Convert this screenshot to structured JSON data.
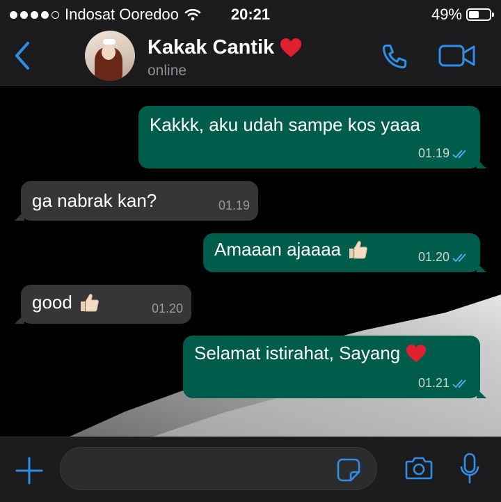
{
  "status_bar": {
    "carrier": "Indosat Ooredoo",
    "time": "20:21",
    "battery_text": "49%",
    "battery_level": 0.49,
    "signal_bars_filled": 4,
    "signal_bars_total": 5
  },
  "header": {
    "back_icon": "chevron-left-icon",
    "contact_name": "Kakak Cantik",
    "name_emoji": "heart",
    "status": "online",
    "call_icon": "phone-icon",
    "video_icon": "video-camera-icon"
  },
  "messages": [
    {
      "direction": "out",
      "text": "Kakkk, aku udah sampe kos yaaa",
      "time": "01.19",
      "read": true
    },
    {
      "direction": "in",
      "text": "ga nabrak kan?",
      "time": "01.19"
    },
    {
      "direction": "out",
      "text": "Amaaan ajaaaa",
      "emoji": "thumbs-up",
      "time": "01.20",
      "read": true
    },
    {
      "direction": "in",
      "text": "good",
      "emoji": "thumbs-up",
      "time": "01.20"
    },
    {
      "direction": "out",
      "text": "Selamat istirahat, Sayang",
      "emoji": "heart",
      "time": "01.21",
      "read": true
    }
  ],
  "input_bar": {
    "plus_icon": "plus-icon",
    "input_value": "",
    "sticker_icon": "sticker-icon",
    "camera_icon": "camera-icon",
    "mic_icon": "microphone-icon"
  },
  "colors": {
    "accent": "#2f8fe8",
    "outgoing_bubble": "#005c4b",
    "incoming_bubble": "#363638",
    "bar_background": "#1c1c1e",
    "read_tick": "#4fb3f6"
  }
}
